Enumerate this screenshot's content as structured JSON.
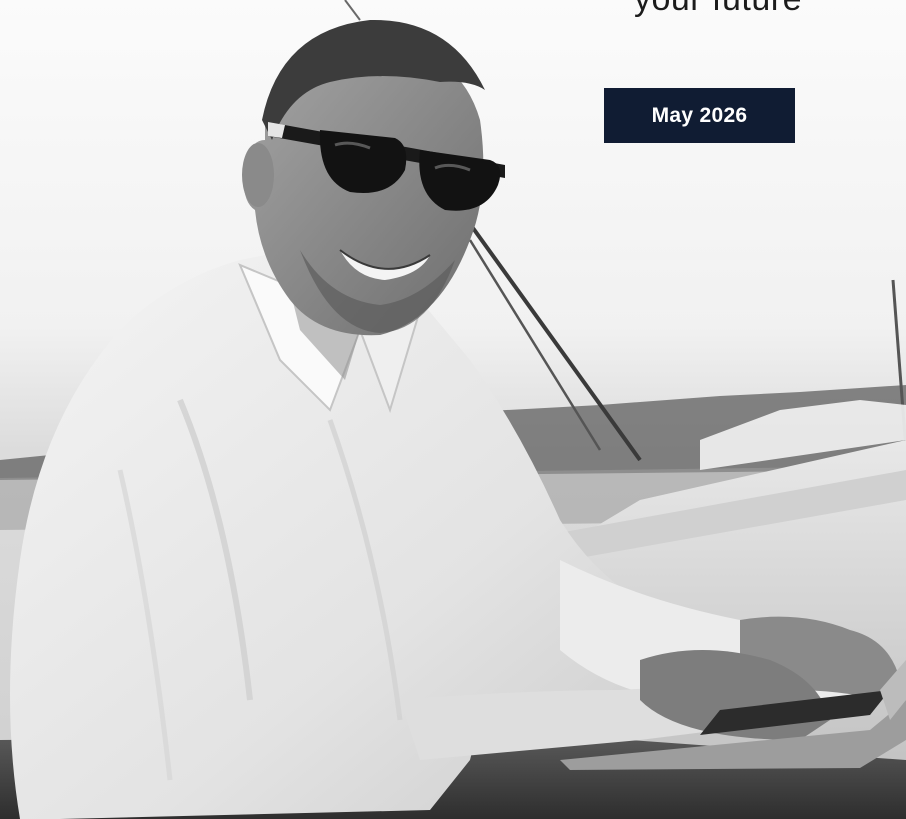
{
  "hero": {
    "tagline": "your future",
    "date_badge": "May 2026",
    "photo_subject": "man-with-sunglasses-typing-on-laptop-on-boat"
  }
}
